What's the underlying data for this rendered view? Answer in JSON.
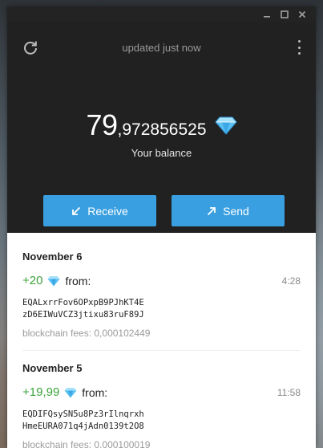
{
  "header": {
    "status_text": "updated just now",
    "balance_integer": "79",
    "balance_fraction": ",972856525",
    "balance_label": "Your balance",
    "receive_label": "Receive",
    "send_label": "Send"
  },
  "colors": {
    "accent": "#3a9fe0",
    "incoming": "#3ca43c",
    "header_bg": "#212121"
  },
  "transactions": [
    {
      "date": "November 6",
      "amount": "+20",
      "direction": "from:",
      "time": "4:28",
      "address_line1": "EQALxrrFov6OPxpB9PJhKT4E",
      "address_line2": "zD6EIWuVCZ3jtixu83ruF89J",
      "fees": "blockchain fees: 0,000102449"
    },
    {
      "date": "November 5",
      "amount": "+19,99",
      "direction": "from:",
      "time": "11:58",
      "address_line1": "EQDIFQsySN5u8Pz3rIlnqrxh",
      "address_line2": "HmeEURA071q4jAdn0139t2O8",
      "fees": "blockchain fees: 0,000100019"
    }
  ]
}
